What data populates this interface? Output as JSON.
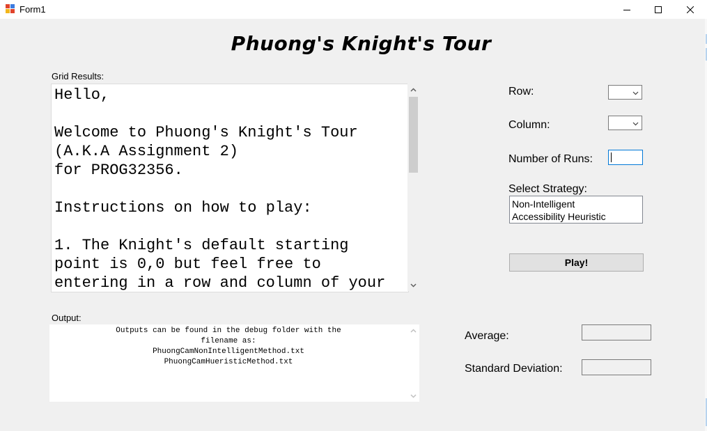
{
  "window": {
    "title": "Form1",
    "controls": [
      "minimize",
      "maximize",
      "close"
    ],
    "icon": "app-icon"
  },
  "heading": "Phuong's Knight's Tour",
  "grid_results": {
    "label": "Grid Results:",
    "text": "Hello,\n\nWelcome to Phuong's Knight's Tour\n(A.K.A Assignment 2)\nfor PROG32356.\n\nInstructions on how to play:\n\n1. The Knight's default starting\npoint is 0,0 but feel free to\nentering in a row and column of your"
  },
  "output": {
    "label": "Output:",
    "text": "Outputs can be found in the debug folder with the\nfilename as:\nPhuongCamNonIntelligentMethod.txt\nPhuongCamHueristicMethod.txt"
  },
  "settings": {
    "row_label": "Row:",
    "row_value": "",
    "column_label": "Column:",
    "column_value": "",
    "runs_label": "Number of Runs:",
    "runs_value": "",
    "strategy_label": "Select Strategy:",
    "strategies": [
      "Non-Intelligent",
      "Accessibility Heuristic"
    ],
    "play_label": "Play!"
  },
  "results": {
    "average_label": "Average:",
    "average_value": "",
    "std_label": "Standard Deviation:",
    "std_value": ""
  },
  "colors": {
    "background": "#f0f0f0",
    "focus_border": "#0078d7",
    "button_face": "#e1e1e1"
  }
}
